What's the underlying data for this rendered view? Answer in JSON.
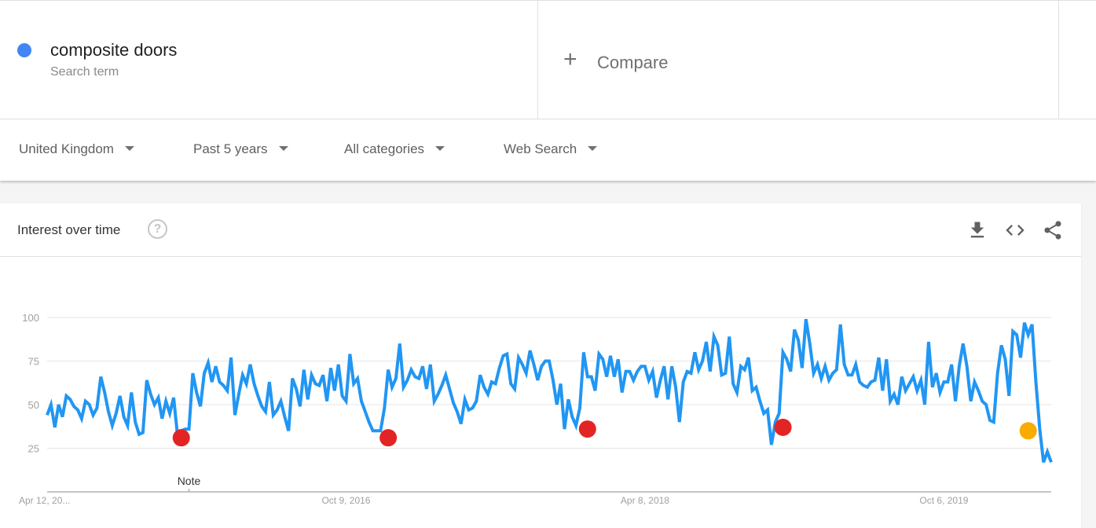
{
  "search_term": {
    "name": "composite doors",
    "type_label": "Search term",
    "color": "#4285f4"
  },
  "compare": {
    "icon": "plus-icon",
    "label": "Compare"
  },
  "filters": [
    {
      "label": "United Kingdom",
      "icon": "caret-down-icon"
    },
    {
      "label": "Past 5 years",
      "icon": "caret-down-icon"
    },
    {
      "label": "All categories",
      "icon": "caret-down-icon"
    },
    {
      "label": "Web Search",
      "icon": "caret-down-icon"
    }
  ],
  "card": {
    "title": "Interest over time",
    "help_icon": "help-icon",
    "help_glyph": "?",
    "actions": [
      "download-icon",
      "embed-icon",
      "share-icon"
    ]
  },
  "chart_data": {
    "type": "line",
    "title": "Interest over time",
    "xlabel": "",
    "ylabel": "",
    "ylim": [
      0,
      100
    ],
    "yticks": [
      25,
      50,
      75,
      100
    ],
    "xtick_labels": [
      "Apr 12, 20...",
      "Oct 9, 2016",
      "Apr 8, 2018",
      "Oct 6, 2019"
    ],
    "xtick_positions_week": [
      0,
      78,
      156,
      234
    ],
    "grid": true,
    "legend": "none",
    "annotation": {
      "label": "Note",
      "week": 37
    },
    "series": [
      {
        "name": "composite doors",
        "color": "#2196f3",
        "values": [
          44,
          50,
          37,
          50,
          43,
          55,
          53,
          49,
          47,
          42,
          52,
          50,
          44,
          48,
          66,
          57,
          46,
          38,
          45,
          55,
          43,
          38,
          57,
          40,
          33,
          34,
          64,
          56,
          50,
          54,
          42,
          52,
          45,
          54,
          33,
          35,
          36,
          36,
          68,
          57,
          49,
          68,
          74,
          63,
          72,
          63,
          61,
          58,
          77,
          44,
          56,
          67,
          62,
          73,
          62,
          55,
          49,
          46,
          63,
          44,
          47,
          52,
          43,
          35,
          65,
          59,
          49,
          70,
          53,
          67,
          62,
          61,
          67,
          52,
          71,
          58,
          73,
          55,
          52,
          79,
          62,
          65,
          52,
          46,
          40,
          35,
          35,
          35,
          48,
          70,
          60,
          65,
          85,
          60,
          64,
          70,
          66,
          65,
          72,
          59,
          73,
          52,
          56,
          61,
          67,
          59,
          51,
          46,
          39,
          53,
          47,
          48,
          52,
          67,
          60,
          56,
          63,
          62,
          71,
          78,
          79,
          62,
          59,
          77,
          73,
          68,
          81,
          73,
          64,
          72,
          75,
          75,
          64,
          50,
          62,
          36,
          53,
          43,
          38,
          48,
          80,
          66,
          66,
          58,
          79,
          76,
          66,
          78,
          66,
          76,
          57,
          69,
          69,
          64,
          69,
          72,
          72,
          64,
          69,
          54,
          64,
          72,
          53,
          72,
          60,
          40,
          63,
          69,
          68,
          80,
          70,
          75,
          86,
          69,
          89,
          84,
          67,
          68,
          89,
          62,
          57,
          72,
          70,
          77,
          58,
          60,
          52,
          45,
          47,
          27,
          40,
          45,
          80,
          76,
          69,
          93,
          87,
          71,
          99,
          85,
          68,
          73,
          65,
          72,
          64,
          68,
          70,
          96,
          73,
          67,
          67,
          73,
          63,
          61,
          60,
          63,
          64,
          77,
          58,
          76,
          52,
          56,
          50,
          66,
          58,
          62,
          66,
          58,
          64,
          50,
          86,
          60,
          68,
          57,
          63,
          63,
          73,
          52,
          72,
          85,
          72,
          52,
          63,
          58,
          52,
          50,
          41,
          40,
          68,
          84,
          76,
          55,
          92,
          90,
          77,
          97,
          90,
          96,
          63,
          36,
          17,
          23,
          17
        ],
        "markers": [
          {
            "week": 35,
            "value": 31,
            "color": "#e32424",
            "kind": "note"
          },
          {
            "week": 89,
            "value": 31,
            "color": "#e32424",
            "kind": "note"
          },
          {
            "week": 141,
            "value": 36,
            "color": "#e32424",
            "kind": "note"
          },
          {
            "week": 192,
            "value": 37,
            "color": "#e32424",
            "kind": "note"
          },
          {
            "week": 256,
            "value": 35,
            "color": "#f9ab00",
            "kind": "partial"
          }
        ]
      }
    ]
  }
}
